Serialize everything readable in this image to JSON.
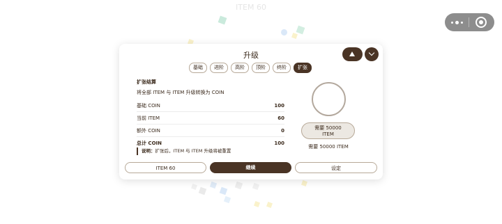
{
  "background": {
    "title": "ITEM 60"
  },
  "capsule": {
    "menu_icon": "more-dots-icon",
    "close_icon": "target-icon"
  },
  "dialog": {
    "title": "升级",
    "top_buttons": [
      "shape-icon",
      "chevron-down-icon"
    ],
    "tabs": [
      {
        "label": "基础",
        "active": false
      },
      {
        "label": "进阶",
        "active": false
      },
      {
        "label": "高阶",
        "active": false
      },
      {
        "label": "顶阶",
        "active": false
      },
      {
        "label": "终阶",
        "active": false
      },
      {
        "label": "扩张",
        "active": true
      }
    ],
    "section_title": "扩张结算",
    "section_desc": "将全部 ITEM 与 ITEM 升级转换为 COIN",
    "rows": [
      {
        "label": "基础 COIN",
        "value": "100"
      },
      {
        "label": "当前 ITEM",
        "value": "60"
      },
      {
        "label": "额外 COIN",
        "value": "0"
      },
      {
        "label": "总计 COIN",
        "value": "100"
      }
    ],
    "note_label": "说明：",
    "note_text": "扩张后，ITEM 与 ITEM 升级将被重置",
    "need_button_line1": "需要 50000",
    "need_button_line2": "ITEM",
    "need_text": "需要 50000 ITEM",
    "bottom_buttons": {
      "left": "ITEM 60",
      "middle": "继续",
      "right": "设定"
    }
  },
  "colors": {
    "primary": "#4a3425",
    "border": "#b7a998",
    "muted_button": "#ece8e2"
  }
}
